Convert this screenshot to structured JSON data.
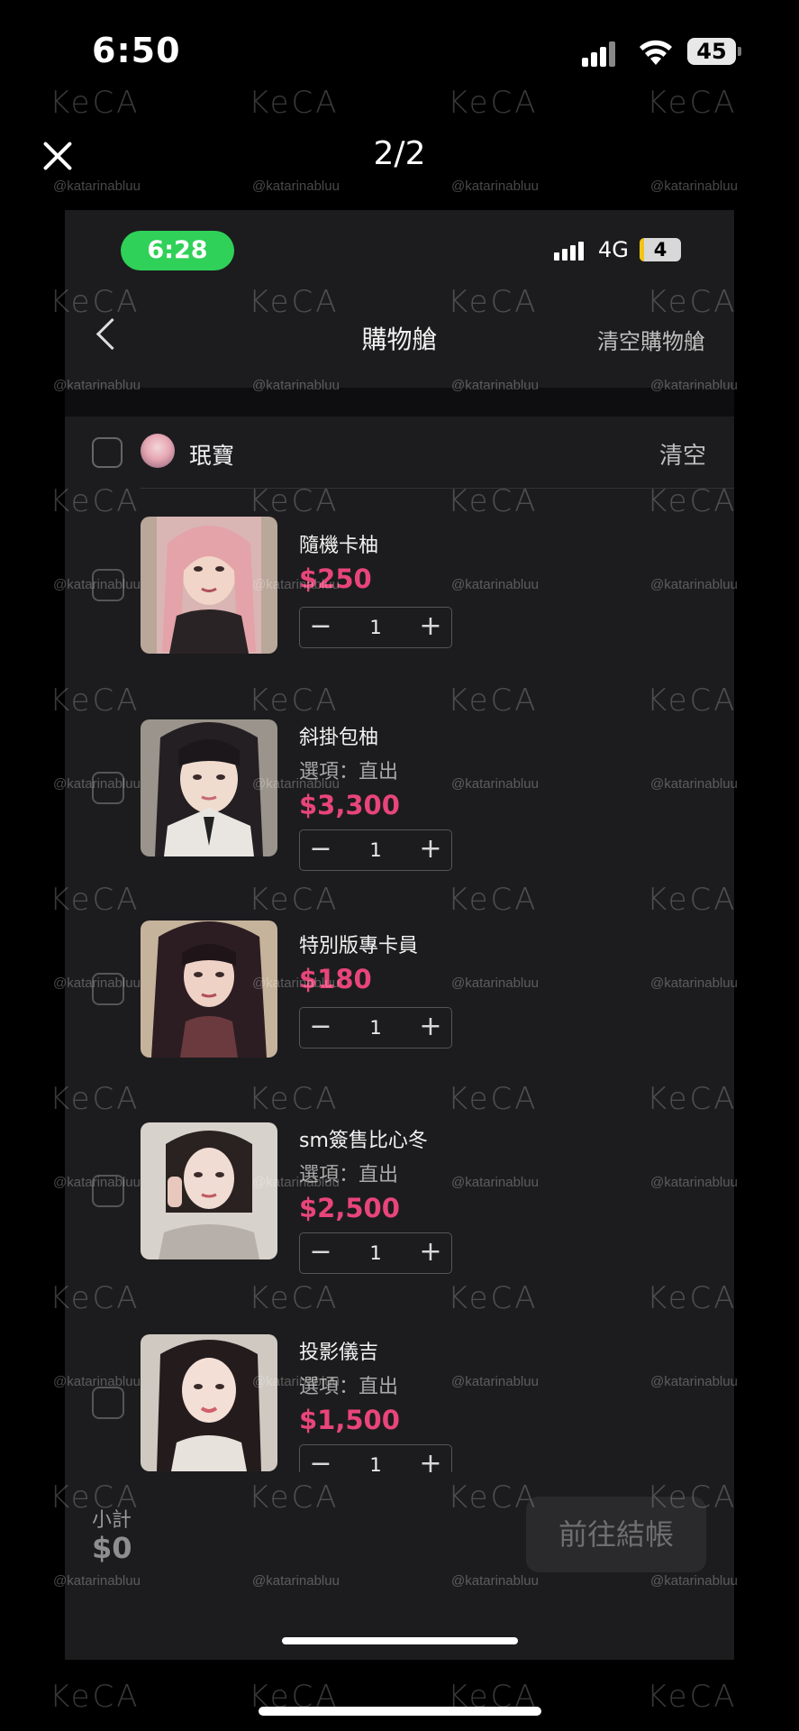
{
  "outer_status": {
    "time": "6:50",
    "battery": "45"
  },
  "viewer": {
    "page_counter": "2/2"
  },
  "inner_status": {
    "time": "6:28",
    "network": "4G",
    "battery": "4"
  },
  "nav": {
    "title": "購物艙",
    "clear_all": "清空購物艙"
  },
  "shop": {
    "name": "珉寶",
    "clear": "清空"
  },
  "items": [
    {
      "name": "隨機卡柚",
      "option": "",
      "price": "$250",
      "qty": "1",
      "minus": "−",
      "plus": "+"
    },
    {
      "name": "斜掛包柚",
      "option": "選項：直出",
      "price": "$3,300",
      "qty": "1",
      "minus": "−",
      "plus": "+"
    },
    {
      "name": "特別版專卡員",
      "option": "",
      "price": "$180",
      "qty": "1",
      "minus": "−",
      "plus": "+"
    },
    {
      "name": "sm簽售比心冬",
      "option": "選項：直出",
      "price": "$2,500",
      "qty": "1",
      "minus": "−",
      "plus": "+"
    },
    {
      "name": "投影儀吉",
      "option": "選項：直出",
      "price": "$1,500",
      "qty": "1",
      "minus": "−",
      "plus": "+"
    }
  ],
  "footer": {
    "subtotal_label": "小計",
    "subtotal_value": "$0",
    "checkout": "前往結帳"
  },
  "watermark": {
    "logo": "KeCA",
    "handle": "@katarinabluu"
  },
  "colors": {
    "price": "#e8457a",
    "time_pill": "#2fd158",
    "background": "#000000",
    "panel": "#1c1c1e"
  }
}
